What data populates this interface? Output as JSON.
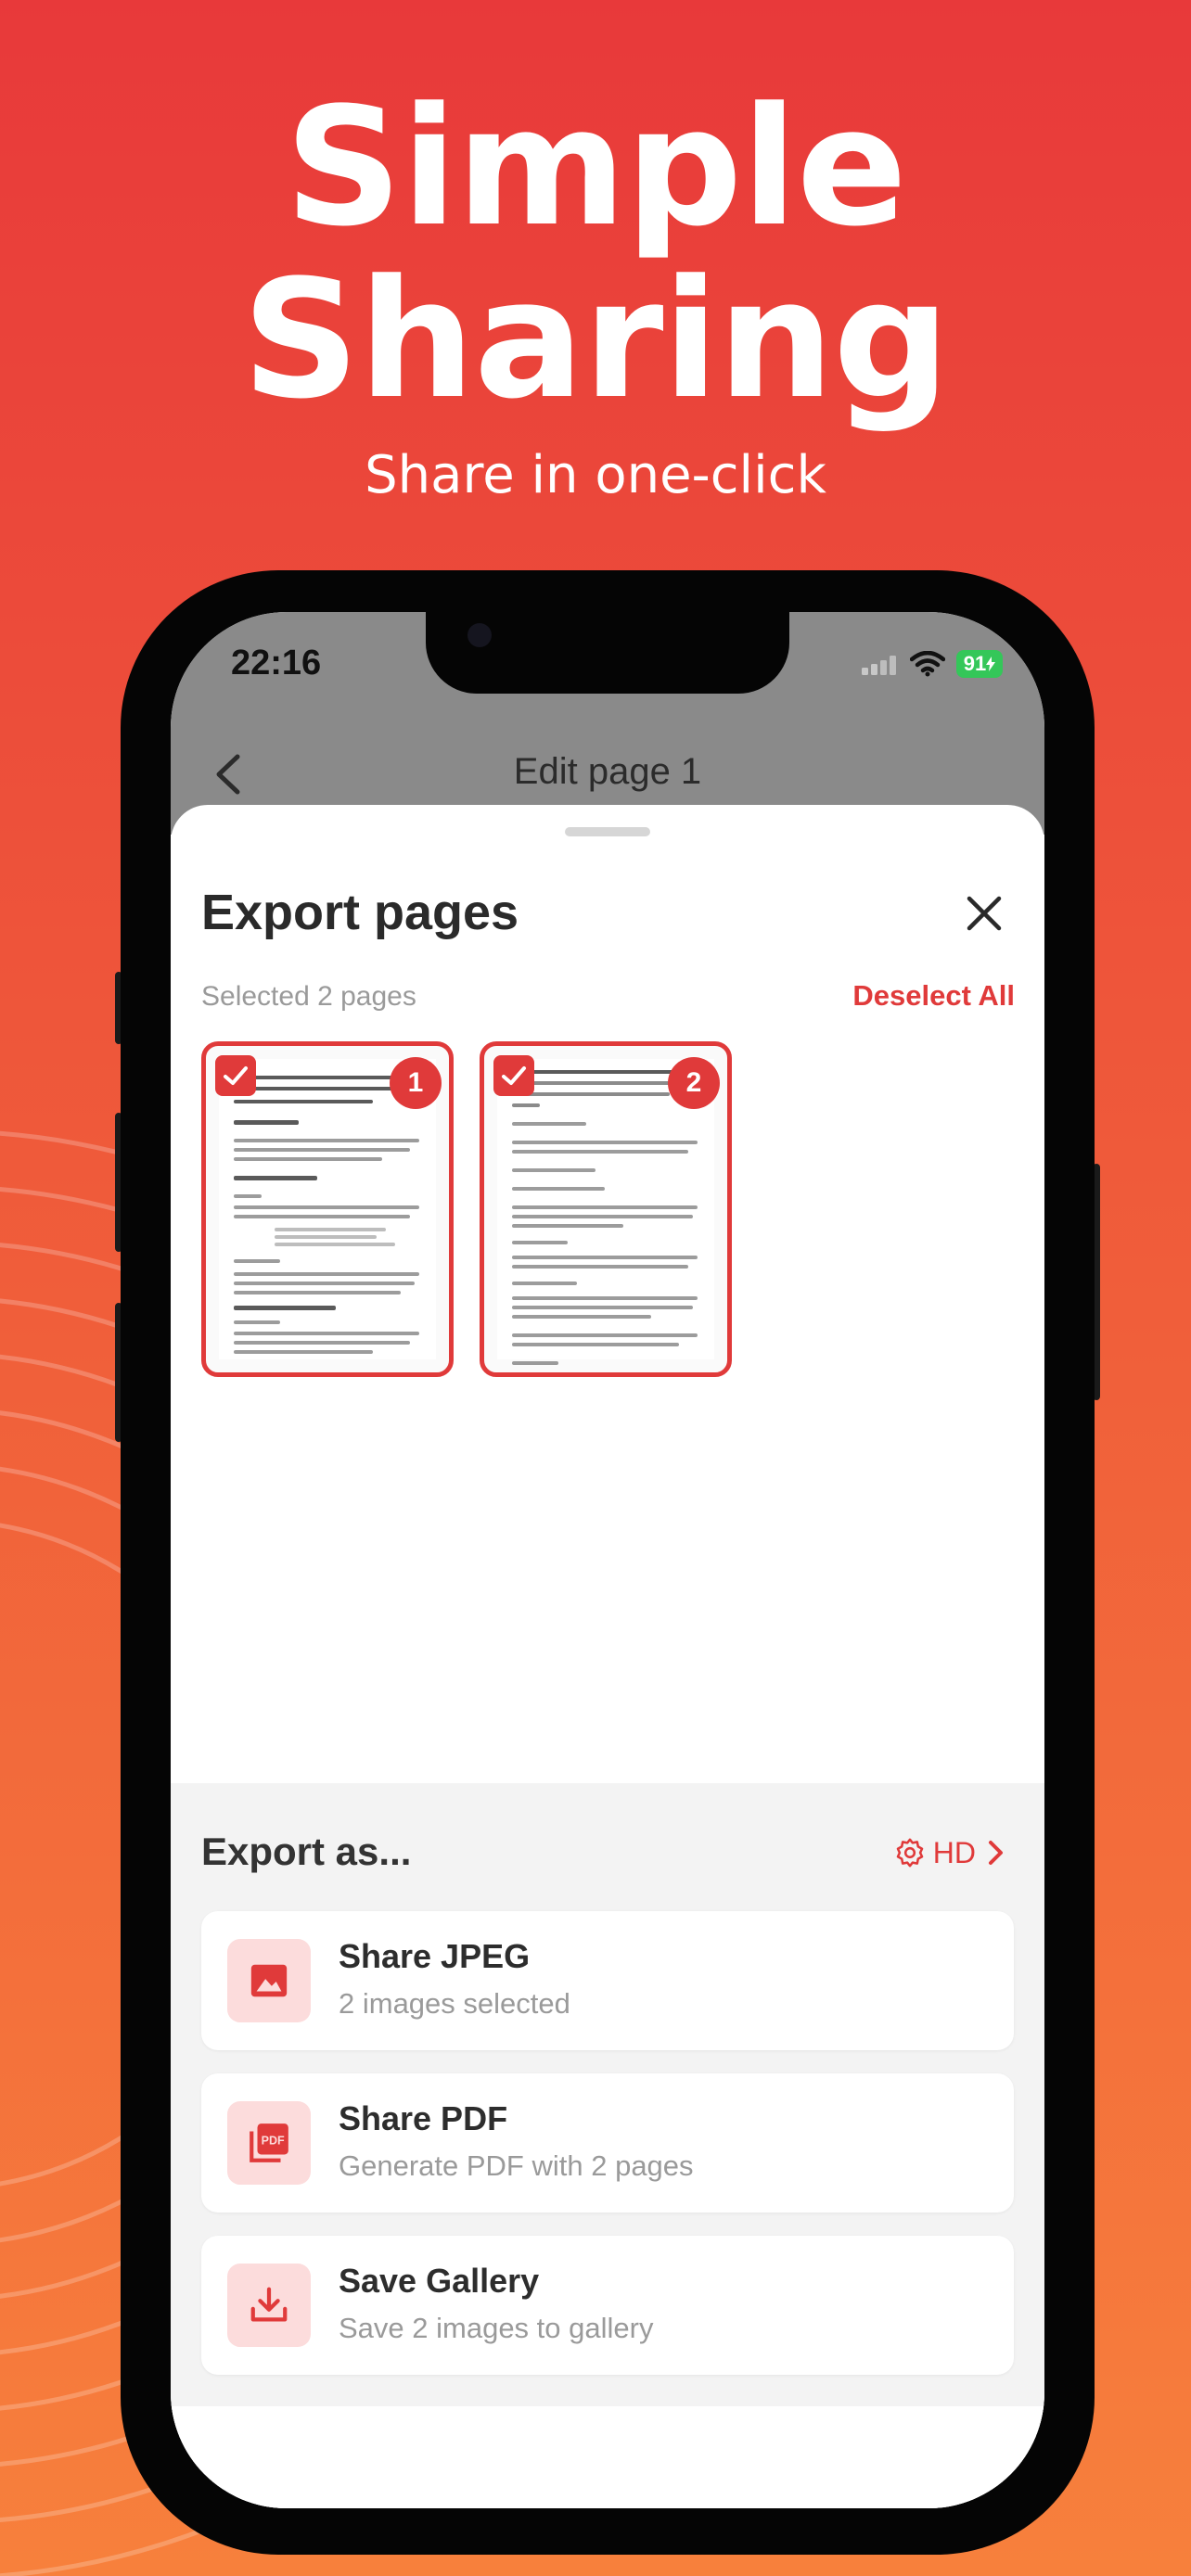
{
  "hero": {
    "title_line1": "Simple",
    "title_line2": "Sharing",
    "subtitle": "Share in one-click"
  },
  "status_bar": {
    "time": "22:16",
    "battery": "91"
  },
  "nav": {
    "title": "Edit page 1",
    "back_icon": "chevron-left-icon"
  },
  "sheet": {
    "title": "Export pages",
    "close_icon": "close-icon",
    "selected_text": "Selected 2 pages",
    "deselect_label": "Deselect All",
    "pages": [
      {
        "number": "1",
        "checked": true
      },
      {
        "number": "2",
        "checked": true
      }
    ]
  },
  "export": {
    "title": "Export as...",
    "quality_label": "HD",
    "quality_icon": "gear-icon",
    "options": [
      {
        "title": "Share JPEG",
        "subtitle": "2 images selected",
        "icon": "image-icon"
      },
      {
        "title": "Share PDF",
        "subtitle": "Generate PDF with 2 pages",
        "icon": "pdf-icon"
      },
      {
        "title": "Save Gallery",
        "subtitle": "Save 2 images to gallery",
        "icon": "download-icon"
      }
    ]
  },
  "colors": {
    "accent": "#e03a3a",
    "background_top": "#e8393a",
    "background_bottom": "#f7803c",
    "icon_tile": "#fcdcdc"
  }
}
